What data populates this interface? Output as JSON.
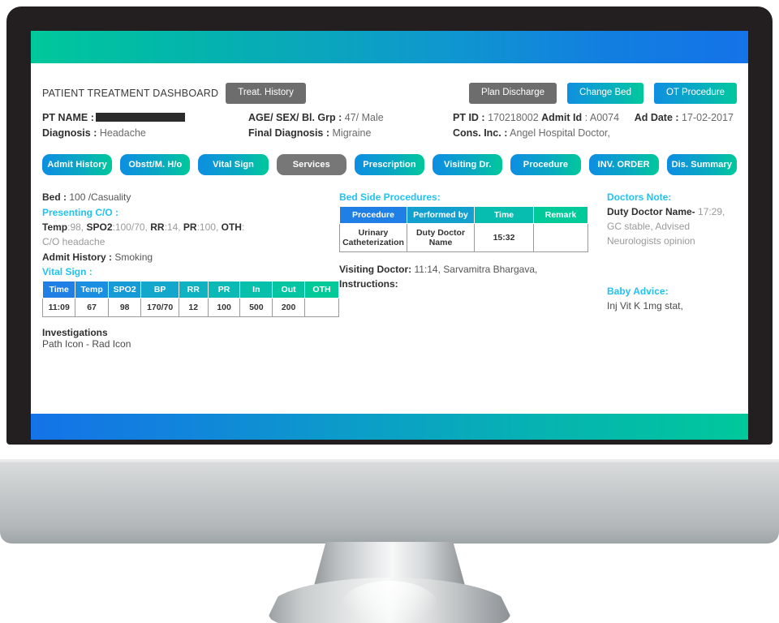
{
  "header": {
    "dashboard_title": "PATIENT TREATMENT DASHBOARD",
    "treat_history_label": "Treat. History",
    "plan_discharge_label": "Plan Discharge",
    "change_bed_label": "Change Bed",
    "ot_procedure_label": "OT Procedure"
  },
  "patient": {
    "pt_name_label": "PT NAME :",
    "pt_name_value": "",
    "diagnosis_label": "Diagnosis :",
    "diagnosis_value": "Headache",
    "age_sex_bl_label": "AGE/ SEX/ Bl. Grp :",
    "age_sex_bl_value": "47/ Male",
    "final_diagnosis_label": "Final Diagnosis :",
    "final_diagnosis_value": "Migraine",
    "pt_id_label": "PT ID :",
    "pt_id_value": "170218002",
    "admit_id_label": "Admit Id",
    "admit_id_value": ": A0074",
    "cons_inc_label": "Cons. Inc. :",
    "cons_inc_value": "Angel Hospital Doctor,",
    "ad_date_label": "Ad Date :",
    "ad_date_value": "17-02-2017"
  },
  "tabs": [
    {
      "label": "Admit History",
      "active": false
    },
    {
      "label": "Obstt/M. H/o",
      "active": false
    },
    {
      "label": "Vital Sign",
      "active": false
    },
    {
      "label": "Services",
      "active": true
    },
    {
      "label": "Prescription",
      "active": false
    },
    {
      "label": "Visiting Dr.",
      "active": false
    },
    {
      "label": "Procedure",
      "active": false
    },
    {
      "label": "INV. ORDER",
      "active": false
    },
    {
      "label": "Dis. Summary",
      "active": false
    }
  ],
  "left": {
    "bed_label": "Bed :",
    "bed_value": "100 /Casuality",
    "presenting_co_heading": "Presenting C/O :",
    "vitals_inline": {
      "temp_label": "Temp",
      "temp_value": ":98, ",
      "spo2_label": "SPO2",
      "spo2_value": ":100/70, ",
      "rr_label": "RR",
      "rr_value": ":14, ",
      "pr_label": "PR",
      "pr_value": ":100, ",
      "oth_label": "OTH",
      "oth_value": ":"
    },
    "co_headache": "C/O headache",
    "admit_history_label": "Admit History :",
    "admit_history_value": "Smoking",
    "vital_sign_heading": "Vital Sign :",
    "vital_table": {
      "columns": [
        "Time",
        "Temp",
        "SPO2",
        "BP",
        "RR",
        "PR",
        "In",
        "Out",
        "OTH"
      ],
      "rows": [
        [
          "11:09",
          "67",
          "98",
          "170/70",
          "12",
          "100",
          "500",
          "200",
          ""
        ]
      ]
    },
    "investigations_heading": "Investigations",
    "investigations_value": "Path Icon - Rad Icon"
  },
  "middle": {
    "bsp_heading": "Bed Side Procedures:",
    "bsp_table": {
      "columns": [
        "Procedure",
        "Performed by",
        "Time",
        "Remark"
      ],
      "rows": [
        [
          "Urinary Catheterization",
          "Duty Doctor Name",
          "15:32",
          ""
        ]
      ]
    },
    "visiting_doctor_label": "Visiting Doctor:",
    "visiting_doctor_value": "11:14, Sarvamitra Bhargava,",
    "instructions_label": "Instructions:"
  },
  "right": {
    "doctors_note_heading": "Doctors Note:",
    "duty_doctor_label": "Duty Doctor Name-",
    "duty_doctor_note": "17:29, GC stable, Advised Neurologists opinion",
    "baby_advice_heading": "Baby Advice:",
    "baby_advice_value": "Inj Vit K 1mg stat,"
  },
  "colors": {
    "accent_teal": "#00c89b",
    "accent_blue": "#1473e8",
    "heading_cyan": "#22c2f0",
    "gray_button": "#6d6d6d",
    "active_tab_gray": "#777777"
  }
}
